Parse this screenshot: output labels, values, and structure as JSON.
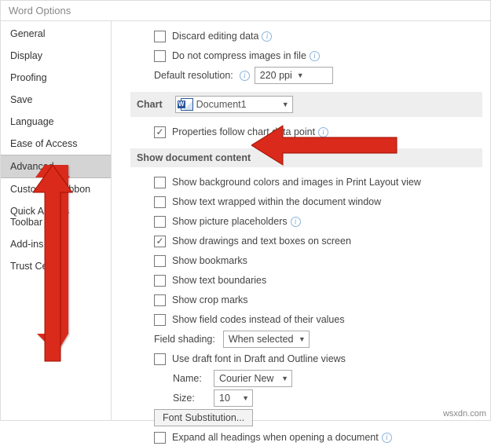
{
  "window": {
    "title": "Word Options"
  },
  "sidebar": {
    "items": [
      {
        "label": "General"
      },
      {
        "label": "Display"
      },
      {
        "label": "Proofing"
      },
      {
        "label": "Save"
      },
      {
        "label": "Language"
      },
      {
        "label": "Ease of Access"
      },
      {
        "label": "Advanced",
        "selected": true
      },
      {
        "label": "Customize Ribbon"
      },
      {
        "label": "Quick Access Toolbar"
      },
      {
        "label": "Add-ins"
      },
      {
        "label": "Trust Center"
      }
    ]
  },
  "content": {
    "discard": "Discard editing data",
    "notcompress": "Do not compress images in file",
    "defaultres_label": "Default resolution:",
    "defaultres_value": "220 ppi",
    "chart_header": "Chart",
    "chart_doc": "Document1",
    "chart_prop": "Properties follow chart data point",
    "showdoc_header": "Show document content",
    "show_bg": "Show background colors and images in Print Layout view",
    "show_wrap": "Show text wrapped within the document window",
    "show_pic": "Show picture placeholders",
    "show_draw": "Show drawings and text boxes on screen",
    "show_book": "Show bookmarks",
    "show_bound": "Show text boundaries",
    "show_crop": "Show crop marks",
    "show_field": "Show field codes instead of their values",
    "fieldshading_label": "Field shading:",
    "fieldshading_value": "When selected",
    "draftfont": "Use draft font in Draft and Outline views",
    "name_label": "Name:",
    "name_value": "Courier New",
    "size_label": "Size:",
    "size_value": "10",
    "fontsub": "Font Substitution...",
    "expand": "Expand all headings when opening a document"
  },
  "watermark": "wsxdn.com"
}
